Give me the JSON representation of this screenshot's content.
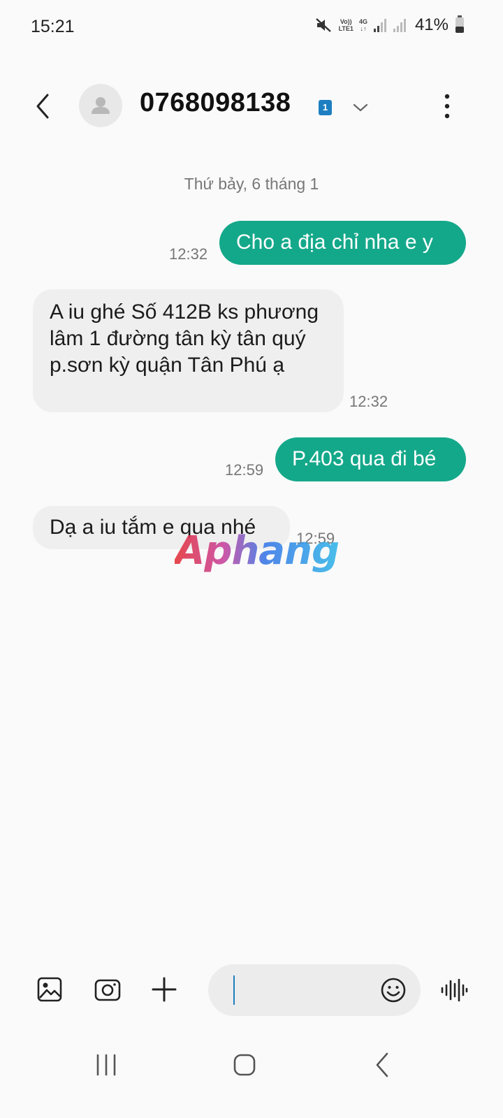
{
  "status_bar": {
    "time": "15:21",
    "volte_line1": "Vo))",
    "volte_line2": "LTE1",
    "network": "4G",
    "battery_percent": "41%",
    "battery_level": 0.41
  },
  "header": {
    "contact": "0768098138",
    "sim_badge": "1",
    "icons": [
      "back-icon",
      "avatar-icon",
      "chevron-down-icon",
      "more-vert-icon"
    ]
  },
  "conversation": {
    "date": "Thứ bảy, 6 tháng 1",
    "messages": [
      {
        "direction": "out",
        "text": "Cho a địa chỉ nha e y",
        "time": "12:32"
      },
      {
        "direction": "in",
        "text": "A iu ghé Số 412B ks phương lâm 1 đường tân kỳ tân quý p.sơn kỳ quận Tân Phú ạ",
        "time": "12:32"
      },
      {
        "direction": "out",
        "text": "P.403 qua đi bé",
        "time": "12:59"
      },
      {
        "direction": "in",
        "text": "Dạ a iu tắm e qua nhé",
        "time": "12:59"
      }
    ]
  },
  "watermark": "Aphang",
  "composer": {
    "value": "",
    "icons": [
      "gallery-icon",
      "camera-icon",
      "plus-icon",
      "emoji-icon",
      "voice-icon"
    ]
  },
  "nav": {
    "icons": [
      "recents-icon",
      "home-icon",
      "back-nav-icon"
    ]
  },
  "colors": {
    "outgoing_bubble": "#14a88a",
    "incoming_bubble": "#efefef",
    "background": "#fafafa",
    "sim_badge": "#1d7fc1"
  }
}
